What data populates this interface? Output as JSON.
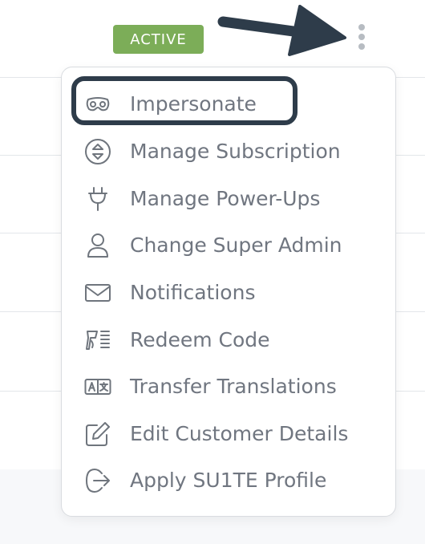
{
  "header": {
    "status_badge": "ACTIVE",
    "colors": {
      "badge_bg": "#7cad58",
      "callout_border": "#2e3c4a",
      "arrow": "#2e3c4a"
    }
  },
  "menu": {
    "items": [
      {
        "label": "Impersonate",
        "icon": "mask-icon",
        "highlighted": true
      },
      {
        "label": "Manage Subscription",
        "icon": "sort-arrows-icon"
      },
      {
        "label": "Manage Power-Ups",
        "icon": "plug-icon"
      },
      {
        "label": "Change Super Admin",
        "icon": "user-icon"
      },
      {
        "label": "Notifications",
        "icon": "envelope-icon"
      },
      {
        "label": "Redeem Code",
        "icon": "redeem-code-icon"
      },
      {
        "label": "Transfer Translations",
        "icon": "translate-icon"
      },
      {
        "label": "Edit Customer Details",
        "icon": "edit-icon"
      },
      {
        "label": "Apply SU1TE Profile",
        "icon": "sign-out-icon"
      }
    ]
  }
}
